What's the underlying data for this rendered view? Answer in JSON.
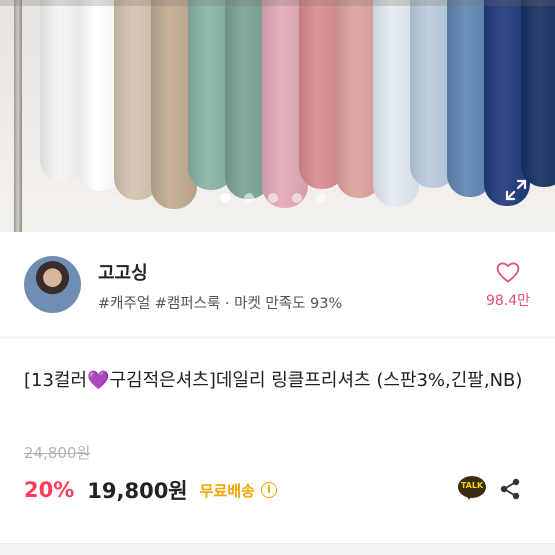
{
  "product_image": {
    "colors": [
      "#f4f4f2",
      "#ffffff",
      "#d6c3b2",
      "#c2ab93",
      "#88b5a5",
      "#7aa396",
      "#e2a9b9",
      "#d98c93",
      "#dea29c",
      "#e3eaf3",
      "#b9ccdf",
      "#5f86b5",
      "#213a7d",
      "#183064"
    ],
    "slide_count": 5,
    "active_slide": 0,
    "expand_icon": "expand-icon"
  },
  "seller": {
    "name": "고고싱",
    "tags": "#캐주얼 #캠퍼스룩 · 마켓 만족도 93%",
    "favorite_count": "98.4만",
    "favorite_icon": "heart-outline-icon",
    "accent": "#e0507a"
  },
  "product": {
    "title_before": "[13컬러",
    "title_heart": "💜",
    "title_after": "구김적은셔츠]데일리 링클프리셔츠 (스판3%,긴팔,NB)",
    "original_price": "24,800원",
    "discount": "20%",
    "price": "19,800원",
    "shipping": "무료배송",
    "info_icon": "i",
    "talk_label": "TALK",
    "discount_color": "#ff3b5c",
    "shipping_color": "#f2a400"
  }
}
